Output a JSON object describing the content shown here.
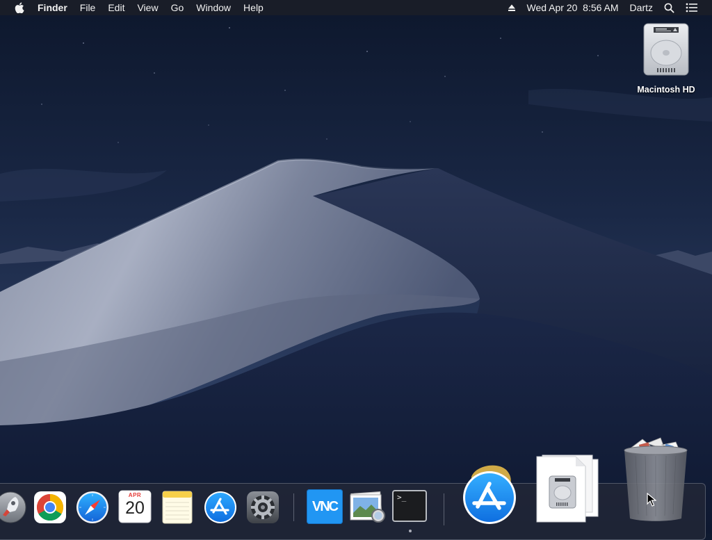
{
  "menubar": {
    "apple_icon": "apple-logo-icon",
    "app_name": "Finder",
    "menus": [
      "File",
      "Edit",
      "View",
      "Go",
      "Window",
      "Help"
    ],
    "status": {
      "eject_icon": "eject-icon",
      "datetime": "Wed Apr 20  8:56 AM",
      "user": "Dartz",
      "spotlight_icon": "search-icon",
      "notification_icon": "notification-center-icon"
    }
  },
  "desktop": {
    "wallpaper": "Mojave dunes at night",
    "icons": [
      {
        "label": "Macintosh HD",
        "icon": "hard-drive-icon"
      }
    ]
  },
  "dock": {
    "apps": [
      {
        "name": "Launchpad",
        "icon": "rocket-icon"
      },
      {
        "name": "Google Chrome",
        "icon": "chrome-icon"
      },
      {
        "name": "Safari",
        "icon": "compass-icon"
      },
      {
        "name": "Calendar",
        "icon": "calendar-icon",
        "month": "APR",
        "day": "20"
      },
      {
        "name": "Notes",
        "icon": "notes-icon"
      },
      {
        "name": "App Store",
        "icon": "app-store-icon"
      },
      {
        "name": "System Preferences",
        "icon": "gear-icon"
      },
      {
        "name": "VNC Viewer",
        "icon": "vnc-icon",
        "glyph": "VNC"
      },
      {
        "name": "Preview",
        "icon": "preview-icon"
      },
      {
        "name": "Terminal",
        "icon": "terminal-icon",
        "prompt": ">_"
      }
    ],
    "stacks": [
      {
        "name": "App Store download",
        "icon": "app-store-icon"
      },
      {
        "name": "Disk image",
        "icon": "hard-drive-icon"
      }
    ],
    "trash": {
      "name": "Trash",
      "icon": "trash-full-icon"
    }
  },
  "colors": {
    "menubar_bg": "#1a1e28",
    "sky_top": "#0f1a30",
    "sky_bottom": "#2e3f63",
    "dune_light": "#9aa3b8",
    "dune_dark": "#1e2b4a",
    "accent_blue": "#1b8ef5"
  }
}
